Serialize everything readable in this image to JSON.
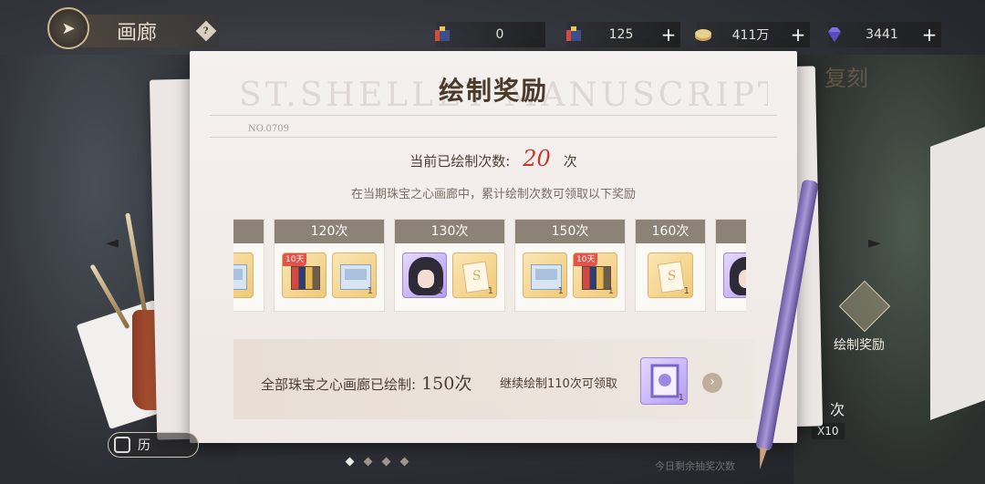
{
  "topbar": {
    "title": "画廊",
    "help_glyph": "?",
    "resources": [
      {
        "icon": "paint-ticket-icon",
        "value": "0"
      },
      {
        "icon": "paint-ticket-10-icon",
        "value": "125"
      },
      {
        "icon": "coin-icon",
        "value": "411万"
      },
      {
        "icon": "diamond-icon",
        "value": "3441"
      }
    ]
  },
  "panel": {
    "title": "绘制奖励",
    "watermark": "ST.SHELLEY MANUSCRIPT",
    "doc_no": "NO.0709",
    "count_label": "当前已绘制次数:",
    "count_value": "20",
    "count_unit": "次",
    "subtitle": "在当期珠宝之心画廊中，累计绘制次数可领取以下奖励",
    "rewards": [
      {
        "label": "",
        "items": [
          {
            "icon": "book-icon",
            "qty": ""
          }
        ]
      },
      {
        "label": "120次",
        "items": [
          {
            "icon": "paint-set-icon",
            "qty": "",
            "tag": "10天"
          },
          {
            "icon": "book-icon",
            "qty": "1"
          }
        ]
      },
      {
        "label": "130次",
        "items": [
          {
            "icon": "character-portrait-icon",
            "qty": "1"
          },
          {
            "icon": "draw-ticket-icon",
            "qty": "1"
          }
        ]
      },
      {
        "label": "150次",
        "items": [
          {
            "icon": "book-icon",
            "qty": "1"
          },
          {
            "icon": "paint-set-icon",
            "qty": "1",
            "tag": "10天"
          }
        ]
      },
      {
        "label": "160次",
        "items": [
          {
            "icon": "draw-ticket-icon",
            "qty": "1"
          }
        ]
      },
      {
        "label": "",
        "items": [
          {
            "icon": "character-portrait-icon",
            "qty": ""
          }
        ]
      }
    ],
    "footer": {
      "total_label": "全部珠宝之心画廊已绘制:",
      "total_value": "150次",
      "note": "继续绘制110次可领取",
      "item_qty": "1"
    }
  },
  "side": {
    "right_label": "复刻",
    "draw_reward_label": "绘制奖励",
    "draw_multi_label": "X10",
    "ci_glyph": "次",
    "history_label": "历",
    "bottom_note": "今日剩余抽奖次数"
  },
  "colors": {
    "accent_red": "#c23a2c",
    "reward_header": "#8d8276",
    "panel_bg": "#f5f1ef"
  }
}
